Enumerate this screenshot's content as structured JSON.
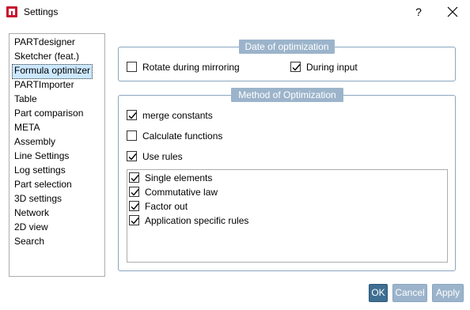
{
  "window": {
    "title": "Settings",
    "help": "?",
    "app_icon": "settings-app-icon",
    "close_icon": "close-icon"
  },
  "nav": {
    "selected_index": 2,
    "items": [
      {
        "label": "PARTdesigner"
      },
      {
        "label": "Sketcher (feat.)"
      },
      {
        "label": "Formula optimizer"
      },
      {
        "label": "PARTImporter"
      },
      {
        "label": "Table"
      },
      {
        "label": "Part comparison"
      },
      {
        "label": "META"
      },
      {
        "label": "Assembly"
      },
      {
        "label": "Line Settings"
      },
      {
        "label": "Log settings"
      },
      {
        "label": "Part selection"
      },
      {
        "label": "3D settings"
      },
      {
        "label": "Network"
      },
      {
        "label": "2D view"
      },
      {
        "label": "Search"
      }
    ]
  },
  "date_group": {
    "title": "Date of optimization",
    "rotate": {
      "label": "Rotate during mirroring",
      "checked": false
    },
    "input": {
      "label": "During input",
      "checked": true
    }
  },
  "method_group": {
    "title": "Method of Optimization",
    "merge": {
      "label": "merge constants",
      "checked": true
    },
    "calculate": {
      "label": "Calculate functions",
      "checked": false
    },
    "use_rules": {
      "label": "Use rules",
      "checked": true
    },
    "rules": [
      {
        "label": "Single elements",
        "checked": true
      },
      {
        "label": "Commutative law",
        "checked": true
      },
      {
        "label": "Factor out",
        "checked": true
      },
      {
        "label": "Application specific rules",
        "checked": true
      }
    ]
  },
  "buttons": {
    "ok": "OK",
    "cancel": "Cancel",
    "apply": "Apply"
  },
  "colors": {
    "accent": "#3e6e92",
    "group_header": "#9cb4cb",
    "selection": "#cce8ff"
  }
}
